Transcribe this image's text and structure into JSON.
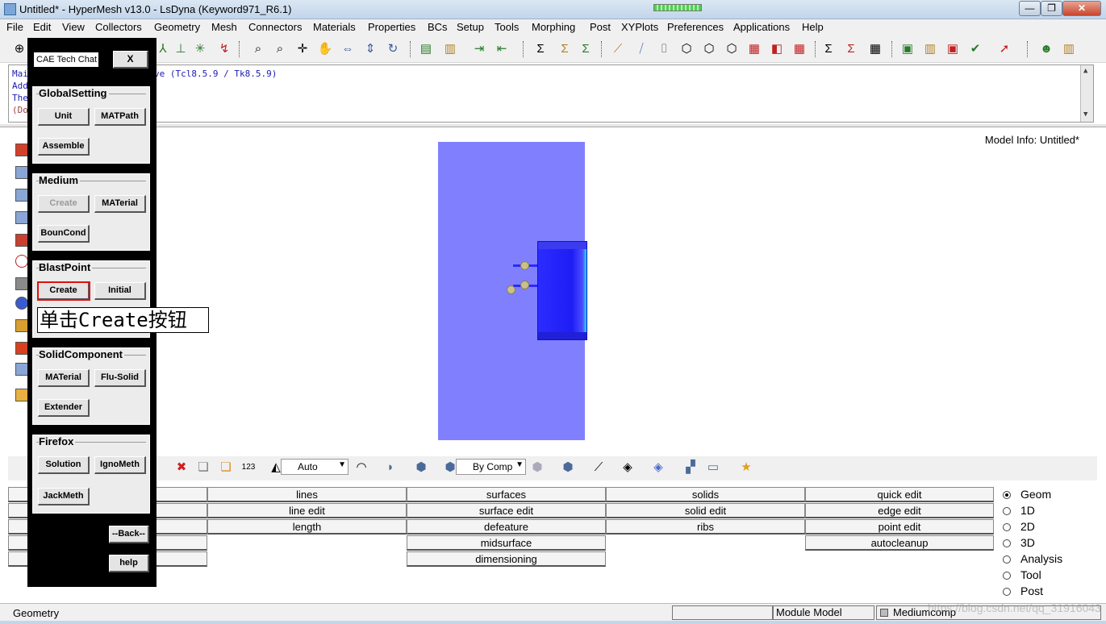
{
  "window": {
    "title": "Untitled* - HyperMesh v13.0 - LsDyna (Keyword971_R6.1)",
    "minimize": "—",
    "maximize": "❐",
    "close": "✕"
  },
  "menu": [
    "File",
    "Edit",
    "View",
    "Collectors",
    "Geometry",
    "Mesh",
    "Connectors",
    "Materials",
    "Properties",
    "BCs",
    "Setup",
    "Tools",
    "Morphing",
    "Post",
    "XYPlots",
    "Preferences",
    "Applications",
    "Help"
  ],
  "command_window": {
    "lines": [
      "Mai",
      "Add",
      "The",
      "(Do"
    ],
    "version_text": "ve (Tcl8.5.9 / Tk8.5.9)"
  },
  "graphics": {
    "model_info": "Model Info: Untitled*"
  },
  "bottom_toolbar": {
    "vis_mode": "Auto",
    "color_mode": "By Comp"
  },
  "panel": {
    "col1": [
      "lines",
      "line edit",
      "length"
    ],
    "col2": [
      "surfaces",
      "surface edit",
      "defeature",
      "midsurface",
      "dimensioning"
    ],
    "col3": [
      "solids",
      "solid edit",
      "ribs"
    ],
    "col4": [
      "quick edit",
      "edge edit",
      "point edit",
      "autocleanup"
    ]
  },
  "radios": [
    {
      "label": "Geom",
      "selected": true
    },
    {
      "label": "1D",
      "selected": false
    },
    {
      "label": "2D",
      "selected": false
    },
    {
      "label": "3D",
      "selected": false
    },
    {
      "label": "Analysis",
      "selected": false
    },
    {
      "label": "Tool",
      "selected": false
    },
    {
      "label": "Post",
      "selected": false
    }
  ],
  "status": {
    "left": "Geometry",
    "module": "Module Model",
    "component": "Mediumcomp",
    "watermark": "https://blog.csdn.net/qq_31916043"
  },
  "overlay": {
    "title": "CAE Tech Chat",
    "close": "X",
    "groups": [
      {
        "title": "GlobalSetting",
        "buttons": [
          "Unit",
          "MATPath",
          "Assemble"
        ]
      },
      {
        "title": "Medium",
        "buttons": [
          "Create",
          "MATerial",
          "BounCond"
        ]
      },
      {
        "title": "BlastPoint",
        "buttons": [
          "Create",
          "Initial"
        ]
      },
      {
        "title": "SolidComponent",
        "buttons": [
          "MATerial",
          "Flu-Solid",
          "Extender"
        ]
      },
      {
        "title": "Firefox",
        "buttons": [
          "Solution",
          "IgnoMeth",
          "JackMeth"
        ]
      }
    ],
    "back": "--Back--",
    "help": "help",
    "callout": "单击Create按钮"
  }
}
